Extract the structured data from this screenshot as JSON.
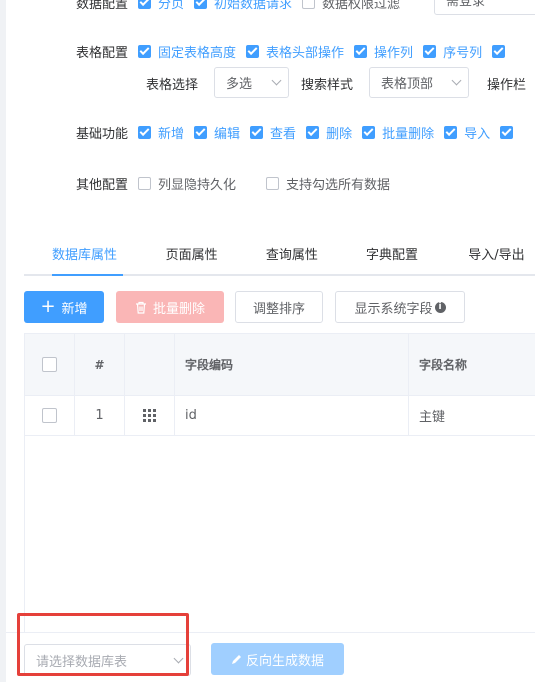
{
  "config": {
    "row0": {
      "label": "数据配置",
      "items": [
        {
          "text": "分页",
          "checked": true
        },
        {
          "text": "初始数据请求",
          "checked": true
        },
        {
          "text": "数据权限过滤",
          "checked": false
        }
      ],
      "select_value": "需登录"
    },
    "row1": {
      "label": "表格配置",
      "items": [
        {
          "text": "固定表格高度",
          "checked": true
        },
        {
          "text": "表格头部操作",
          "checked": true
        },
        {
          "text": "操作列",
          "checked": true
        },
        {
          "text": "序号列",
          "checked": true
        }
      ]
    },
    "row2": {
      "table_select_label": "表格选择",
      "table_select_value": "多选",
      "search_style_label": "搜索样式",
      "search_style_value": "表格顶部",
      "action_col_label": "操作栏"
    },
    "row3": {
      "label": "基础功能",
      "items": [
        {
          "text": "新增",
          "checked": true
        },
        {
          "text": "编辑",
          "checked": true
        },
        {
          "text": "查看",
          "checked": true
        },
        {
          "text": "删除",
          "checked": true
        },
        {
          "text": "批量删除",
          "checked": true
        },
        {
          "text": "导入",
          "checked": true
        }
      ]
    },
    "row4": {
      "label": "其他配置",
      "items": [
        {
          "text": "列显隐持久化",
          "checked": false
        },
        {
          "text": "支持勾选所有数据",
          "checked": false
        }
      ]
    }
  },
  "tabs": [
    "数据库属性",
    "页面属性",
    "查询属性",
    "字典配置",
    "导入/导出"
  ],
  "toolbar": {
    "add": "新增",
    "batch_delete": "批量删除",
    "sort": "调整排序",
    "show_system": "显示系统字段"
  },
  "table": {
    "headers": {
      "index": "#",
      "code": "字段编码",
      "name": "字段名称"
    },
    "rows": [
      {
        "index": "1",
        "code": "id",
        "name": "主键"
      }
    ]
  },
  "footer": {
    "db_select_placeholder": "请选择数据库表",
    "reverse_generate": "反向生成数据"
  },
  "colors": {
    "primary": "#409eff",
    "highlight_box": "#e5403a"
  }
}
